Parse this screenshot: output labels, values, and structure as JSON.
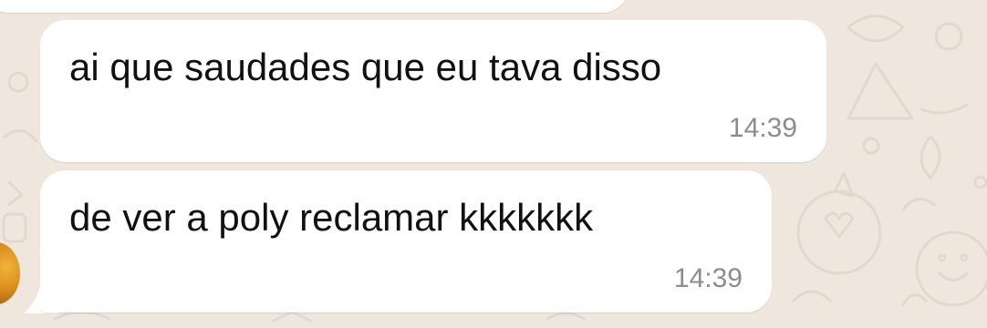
{
  "chat": {
    "messages": [
      {
        "text": "ai que saudades que eu tava disso",
        "time": "14:39"
      },
      {
        "text": "de ver a poly reclamar kkkkkkk",
        "time": "14:39"
      }
    ]
  },
  "colors": {
    "wallpaper": "#efe7de",
    "bubble": "#ffffff",
    "message_text": "#111111",
    "timestamp": "#8c8c8c"
  }
}
